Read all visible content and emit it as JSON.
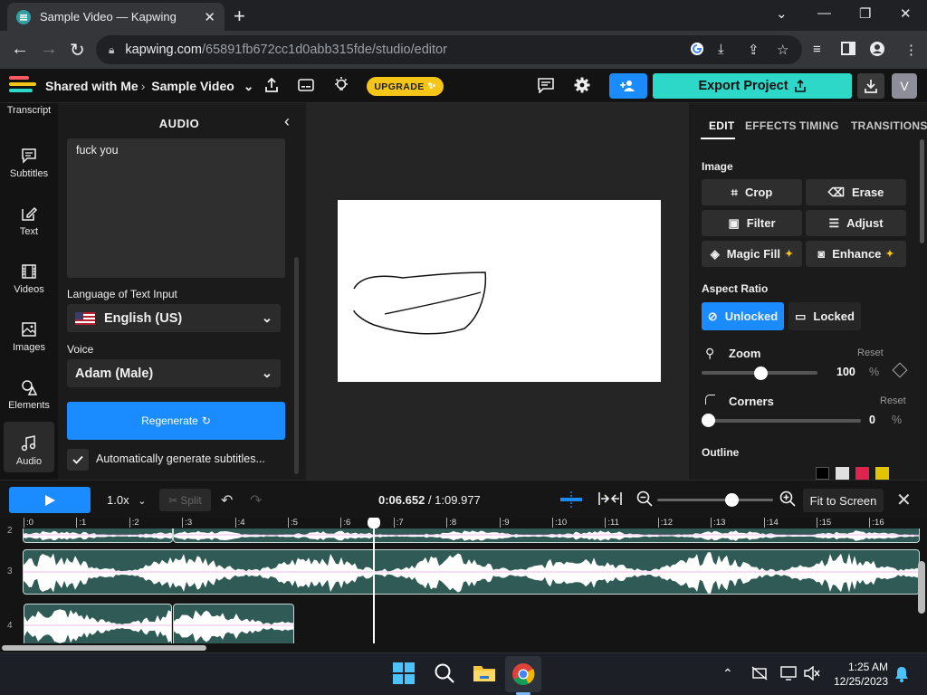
{
  "browser": {
    "tab_title": "Sample Video — Kapwing",
    "url_host": "kapwing.com",
    "url_path": "/65891fb672cc1d0abb315fde/studio/editor"
  },
  "header": {
    "breadcrumb_parent": "Shared with Me",
    "project_name": "Sample Video",
    "upgrade_label": "UPGRADE",
    "export_label": "Export Project",
    "avatar_letter": "V",
    "brand_colors": [
      "#2ed8c9",
      "#1a8cff",
      "#f5c518",
      "#ff5a5f"
    ]
  },
  "leftnav": [
    {
      "label": "Transcript",
      "icon": "transcript-icon"
    },
    {
      "label": "Subtitles",
      "icon": "subtitles-icon"
    },
    {
      "label": "Text",
      "icon": "text-icon"
    },
    {
      "label": "Videos",
      "icon": "videos-icon"
    },
    {
      "label": "Images",
      "icon": "images-icon"
    },
    {
      "label": "Elements",
      "icon": "elements-icon"
    },
    {
      "label": "Audio",
      "icon": "audio-icon"
    }
  ],
  "audio_panel": {
    "title": "AUDIO",
    "text_input": "fuck you",
    "language_label": "Language of Text Input",
    "language_value": "English (US)",
    "voice_label": "Voice",
    "voice_value": "Adam (Male)",
    "regenerate_label": "Regenerate",
    "auto_subtitles_label": "Automatically generate subtitles...",
    "auto_subtitles_checked": true
  },
  "right_panel": {
    "tabs": [
      "EDIT",
      "EFFECTS",
      "TIMING",
      "TRANSITIONS"
    ],
    "active_tab": "EDIT",
    "image_heading": "Image",
    "image_buttons": [
      "Crop",
      "Erase",
      "Filter",
      "Adjust",
      "Magic Fill",
      "Enhance"
    ],
    "aspect_heading": "Aspect Ratio",
    "aspect_options": [
      "Unlocked",
      "Locked"
    ],
    "aspect_selected": "Unlocked",
    "zoom_label": "Zoom",
    "zoom_reset": "Reset",
    "zoom_value": "100",
    "zoom_unit": "%",
    "corners_label": "Corners",
    "corners_reset": "Reset",
    "corners_value": "0",
    "corners_unit": "%",
    "outline_heading": "Outline"
  },
  "timeline": {
    "speed": "1.0x",
    "split_label": "Split",
    "current_time": "0:06.652",
    "separator": " / ",
    "total_time": "1:09.977",
    "fit_label": "Fit to Screen",
    "ruler_ticks": [
      ":0",
      ":1",
      ":2",
      ":3",
      ":4",
      ":5",
      ":6",
      ":7",
      ":8",
      ":9",
      ":10",
      ":11",
      ":12",
      ":13",
      ":14",
      ":15",
      ":16"
    ],
    "track_numbers": [
      "2",
      "3",
      "4"
    ]
  },
  "taskbar": {
    "time": "1:25 AM",
    "date": "12/25/2023"
  }
}
